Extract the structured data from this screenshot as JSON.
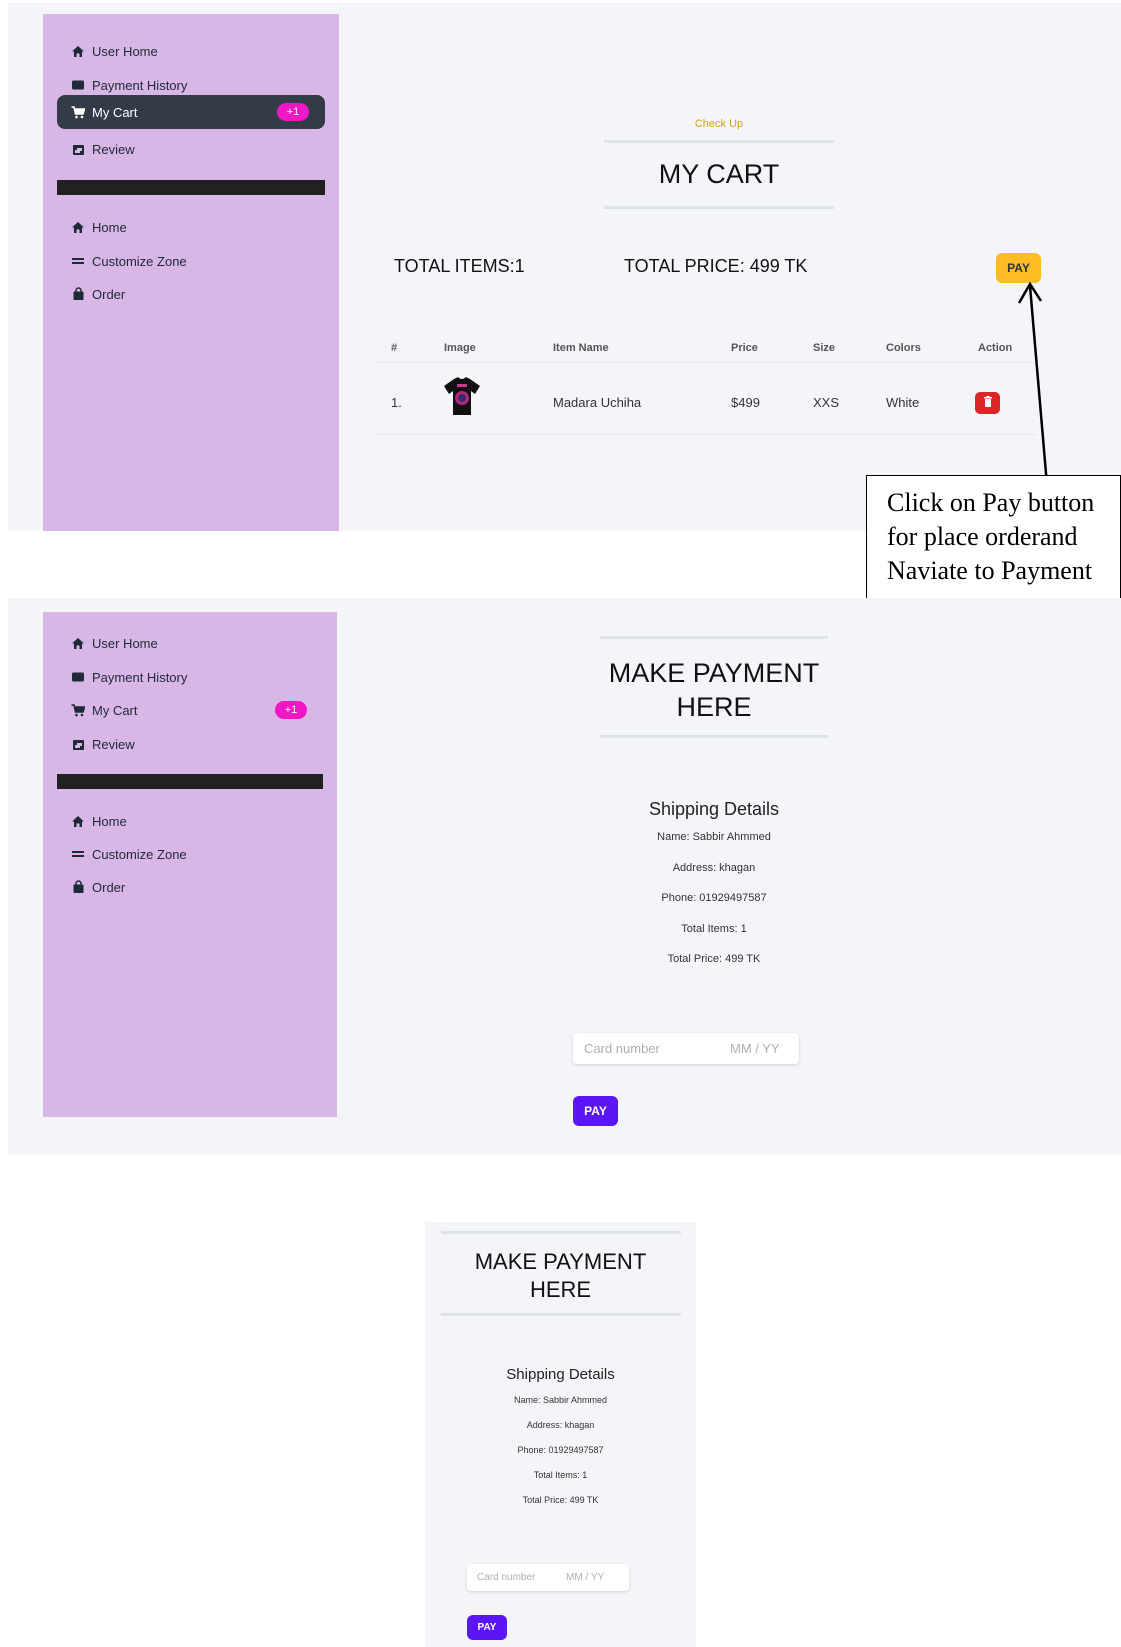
{
  "sidebar": {
    "user_home": "User Home",
    "payment_history": "Payment History",
    "my_cart": "My Cart",
    "cart_badge": "+1",
    "review": "Review",
    "home": "Home",
    "customize_zone": "Customize Zone",
    "order": "Order"
  },
  "cart": {
    "subtitle": "Check Up",
    "title": "MY CART",
    "total_items": "TOTAL ITEMS:1",
    "total_price": "TOTAL PRICE: 499 TK",
    "pay_label": "PAY",
    "columns": [
      "#",
      "Image",
      "Item Name",
      "Price",
      "Size",
      "Colors",
      "Action"
    ],
    "rows": [
      {
        "index": "1.",
        "item_name": "Madara Uchiha",
        "price": "$499",
        "size": "XXS",
        "color": "White"
      }
    ]
  },
  "annotation": {
    "text": "Click on Pay button for place orderand Naviate to Payment page"
  },
  "payment": {
    "title_line1": "MAKE PAYMENT",
    "title_line2": "HERE",
    "shipping_heading": "Shipping Details",
    "name": "Name: Sabbir Ahmmed",
    "address": "Address: khagan",
    "phone": "Phone: 01929497587",
    "total_items": "Total Items: 1",
    "total_price": "Total Price: 499 TK",
    "card_placeholder": "Card number",
    "expiry_placeholder": "MM / YY",
    "pay_label": "PAY"
  },
  "colors": {
    "sidebar_bg": "#d8b6e6",
    "badge": "#f018c4",
    "pay_yellow": "#fbbd23",
    "pay_purple": "#5b16f5",
    "delete_red": "#dc2626",
    "check_up_text": "#d4a017"
  },
  "icons": {
    "user_home": "home-icon",
    "payment_history": "wallet-icon",
    "my_cart": "cart-icon",
    "review": "calendar-icon",
    "home": "home-icon",
    "customize_zone": "menu-icon",
    "order": "bag-icon",
    "delete": "trash-icon"
  }
}
